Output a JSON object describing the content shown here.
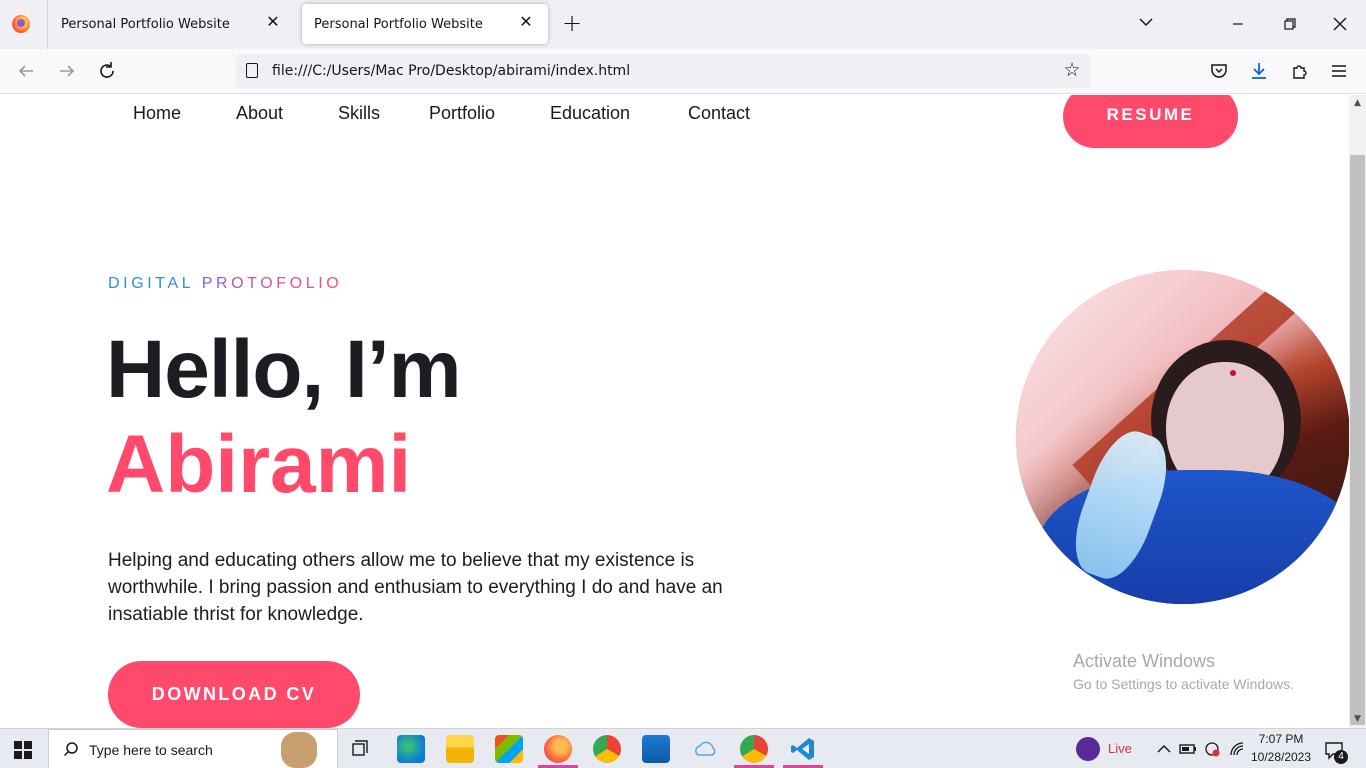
{
  "browser": {
    "tabs": [
      {
        "title": "Personal Portfolio Website",
        "active": false
      },
      {
        "title": "Personal Portfolio Website",
        "active": true
      }
    ],
    "url": "file:///C:/Users/Mac Pro/Desktop/abirami/index.html",
    "icons": {
      "back": "←",
      "forward": "→",
      "reload": "↻",
      "star": "☆",
      "minimize": "—",
      "restore": "❐",
      "close": "✕",
      "new_tab": "+",
      "tab_list": "⌄",
      "tab_close": "✕"
    }
  },
  "site": {
    "nav": [
      "Home",
      "About",
      "Skills",
      "Portfolio",
      "Education",
      "Contact"
    ],
    "resume_label": "RESUME",
    "eyebrow_part1": "DIGITAL ",
    "eyebrow_part2": "PROTOFOLIO",
    "greeting": "Hello, I’m",
    "name": "Abirami",
    "intro": "Helping and educating others allow me to believe that my existence is worthwhile. I bring passion and enthusiam to everything I do and have an insatiable thrist for knowledge.",
    "download_label": "DOWNLOAD CV",
    "accent_color": "#ff4a6b",
    "eyebrow_blue": "#2f8fd8"
  },
  "watermark": {
    "line1": "Activate Windows",
    "line2": "Go to Settings to activate Windows."
  },
  "taskbar": {
    "search_placeholder": "Type here to search",
    "live_label": "Live",
    "time": "7:07 PM",
    "date": "10/28/2023",
    "notification_count": "4"
  }
}
